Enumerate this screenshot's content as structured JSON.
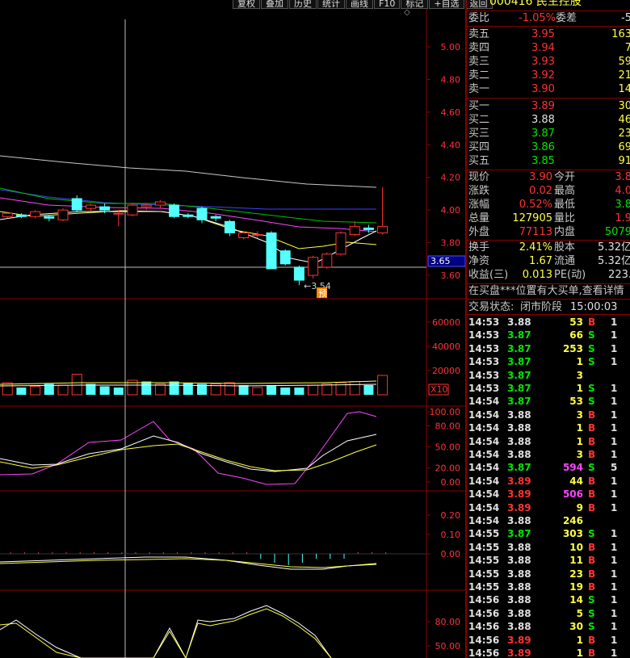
{
  "toolbar": [
    "复权",
    "叠加",
    "历史",
    "统计",
    "画线",
    "F10",
    "标记",
    "+自选",
    "返回"
  ],
  "crosshair_price": "3.65",
  "low_marker": "3.54",
  "badge": "预",
  "main_axis": [
    "5.00",
    "4.80",
    "4.60",
    "4.40",
    "4.20",
    "4.00",
    "3.80",
    "3.60"
  ],
  "vol_axis": [
    "60000",
    "40000",
    "20000"
  ],
  "vol_unit": "X10",
  "kdj_axis": [
    "100.00",
    "80.00",
    "50.00",
    "20.00",
    "0.00"
  ],
  "macd_axis": [
    "0.20",
    "0.10",
    "0.00"
  ],
  "osc_axis": [
    "80.00",
    "50.00"
  ],
  "chart_data": {
    "type": "candlestick",
    "ylim": [
      3.5,
      5.1
    ],
    "candles": [
      {
        "o": 3.95,
        "c": 3.93,
        "h": 3.97,
        "l": 3.91
      },
      {
        "o": 3.96,
        "c": 3.98,
        "h": 3.99,
        "l": 3.95
      },
      {
        "o": 3.97,
        "c": 3.96,
        "h": 3.98,
        "l": 3.95
      },
      {
        "o": 3.96,
        "c": 3.99,
        "h": 4.0,
        "l": 3.95
      },
      {
        "o": 3.96,
        "c": 3.95,
        "h": 3.97,
        "l": 3.93
      },
      {
        "o": 3.94,
        "c": 4.0,
        "h": 4.01,
        "l": 3.93
      },
      {
        "o": 4.07,
        "c": 4.0,
        "h": 4.09,
        "l": 3.99
      },
      {
        "o": 4.01,
        "c": 4.03,
        "h": 4.04,
        "l": 3.99
      },
      {
        "o": 4.02,
        "c": 4.0,
        "h": 4.04,
        "l": 3.98
      },
      {
        "o": 3.98,
        "c": 3.98,
        "h": 4.0,
        "l": 3.9
      },
      {
        "o": 3.97,
        "c": 4.03,
        "h": 4.04,
        "l": 3.96
      },
      {
        "o": 4.02,
        "c": 4.03,
        "h": 4.04,
        "l": 4.0
      },
      {
        "o": 4.03,
        "c": 4.05,
        "h": 4.06,
        "l": 4.01
      },
      {
        "o": 4.03,
        "c": 3.96,
        "h": 4.04,
        "l": 3.95
      },
      {
        "o": 3.97,
        "c": 3.96,
        "h": 3.98,
        "l": 3.95
      },
      {
        "o": 4.01,
        "c": 3.94,
        "h": 4.02,
        "l": 3.92
      },
      {
        "o": 3.96,
        "c": 3.95,
        "h": 3.97,
        "l": 3.93
      },
      {
        "o": 3.93,
        "c": 3.86,
        "h": 3.94,
        "l": 3.84
      },
      {
        "o": 3.83,
        "c": 3.86,
        "h": 3.87,
        "l": 3.82
      },
      {
        "o": 3.85,
        "c": 3.85,
        "h": 3.87,
        "l": 3.83
      },
      {
        "o": 3.86,
        "c": 3.64,
        "h": 3.87,
        "l": 3.64
      },
      {
        "o": 3.75,
        "c": 3.67,
        "h": 3.76,
        "l": 3.66
      },
      {
        "o": 3.65,
        "c": 3.57,
        "h": 3.66,
        "l": 3.54
      },
      {
        "o": 3.6,
        "c": 3.71,
        "h": 3.72,
        "l": 3.58
      },
      {
        "o": 3.65,
        "c": 3.73,
        "h": 3.74,
        "l": 3.64
      },
      {
        "o": 3.73,
        "c": 3.86,
        "h": 3.87,
        "l": 3.72
      },
      {
        "o": 3.85,
        "c": 3.9,
        "h": 3.93,
        "l": 3.84
      },
      {
        "o": 3.89,
        "c": 3.88,
        "h": 3.91,
        "l": 3.86
      },
      {
        "o": 3.86,
        "c": 3.9,
        "h": 4.14,
        "l": 3.85
      }
    ],
    "volume": [
      8000,
      10000,
      6000,
      7000,
      9000,
      8000,
      17000,
      9000,
      7000,
      6000,
      12000,
      11000,
      9000,
      11000,
      10000,
      9000,
      9000,
      10000,
      8000,
      6000,
      8000,
      6000,
      6000,
      8000,
      9000,
      10000,
      11000,
      8000,
      16000
    ],
    "volume_color": [
      "grn",
      "red",
      "grn",
      "red",
      "grn",
      "red",
      "red",
      "grn",
      "grn",
      "grn",
      "red",
      "grn",
      "red",
      "grn",
      "grn",
      "grn",
      "red",
      "red",
      "grn",
      "red",
      "grn",
      "grn",
      "grn",
      "red",
      "red",
      "red",
      "red",
      "grn",
      "red"
    ]
  },
  "stock_title": "000416 民生控股",
  "panel": {
    "rows1": [
      {
        "l": "委比",
        "v": "-1.05%",
        "vc": "red",
        "l2": "委差",
        "v2": "-5",
        "v2c": "wht"
      }
    ],
    "asks": [
      {
        "l": "卖五",
        "p": "3.95",
        "pc": "red",
        "q": "163"
      },
      {
        "l": "卖四",
        "p": "3.94",
        "pc": "red",
        "q": "7"
      },
      {
        "l": "卖三",
        "p": "3.93",
        "pc": "red",
        "q": "59"
      },
      {
        "l": "卖二",
        "p": "3.92",
        "pc": "red",
        "q": "21"
      },
      {
        "l": "卖一",
        "p": "3.90",
        "pc": "red",
        "q": "14"
      }
    ],
    "bids": [
      {
        "l": "买一",
        "p": "3.89",
        "pc": "red",
        "q": "30"
      },
      {
        "l": "买二",
        "p": "3.88",
        "pc": "wht",
        "q": "46"
      },
      {
        "l": "买三",
        "p": "3.87",
        "pc": "grn",
        "q": "23"
      },
      {
        "l": "买四",
        "p": "3.86",
        "pc": "grn",
        "q": "69"
      },
      {
        "l": "买五",
        "p": "3.85",
        "pc": "grn",
        "q": "91"
      }
    ],
    "stats": [
      {
        "l": "现价",
        "v": "3.90",
        "vc": "red",
        "l2": "今开",
        "v2": "3.8",
        "v2c": "red"
      },
      {
        "l": "涨跌",
        "v": "0.02",
        "vc": "red",
        "l2": "最高",
        "v2": "4.0",
        "v2c": "red"
      },
      {
        "l": "涨幅",
        "v": "0.52%",
        "vc": "red",
        "l2": "最低",
        "v2": "3.8",
        "v2c": "grn"
      },
      {
        "l": "总量",
        "v": "127905",
        "vc": "ylw",
        "l2": "量比",
        "v2": "1.9",
        "v2c": "red"
      },
      {
        "l": "外盘",
        "v": "77113",
        "vc": "red",
        "l2": "内盘",
        "v2": "5079",
        "v2c": "grn"
      }
    ],
    "stats2": [
      {
        "l": "换手",
        "v": "2.41%",
        "vc": "ylw",
        "l2": "股本",
        "v2": "5.32亿",
        "v2c": "wht"
      },
      {
        "l": "净资",
        "v": "1.67",
        "vc": "ylw",
        "l2": "流通",
        "v2": "5.32亿",
        "v2c": "wht"
      },
      {
        "l": "收益(三)",
        "v": "0.013",
        "vc": "ylw",
        "l2": "PE(动)",
        "v2": "223.",
        "v2c": "wht"
      }
    ],
    "notice": "在买盘***位置有大买单,查看详情",
    "state_label": "交易状态:",
    "state_value": "闭市阶段",
    "state_time": "15:00:03"
  },
  "ticks": [
    {
      "t": "14:53",
      "p": "3.88",
      "pc": "wht",
      "v": "53",
      "vc": "ylw",
      "s": "B",
      "sc": "red",
      "x": "1"
    },
    {
      "t": "14:53",
      "p": "3.87",
      "pc": "grn",
      "v": "66",
      "vc": "ylw",
      "s": "S",
      "sc": "grn",
      "x": "1"
    },
    {
      "t": "14:53",
      "p": "3.87",
      "pc": "grn",
      "v": "253",
      "vc": "ylw",
      "s": "S",
      "sc": "grn",
      "x": "1"
    },
    {
      "t": "14:53",
      "p": "3.87",
      "pc": "grn",
      "v": "1",
      "vc": "ylw",
      "s": "S",
      "sc": "grn",
      "x": "1"
    },
    {
      "t": "14:53",
      "p": "3.87",
      "pc": "grn",
      "v": "3",
      "vc": "ylw",
      "s": "",
      "sc": "grn",
      "x": ""
    },
    {
      "t": "14:53",
      "p": "3.87",
      "pc": "grn",
      "v": "1",
      "vc": "ylw",
      "s": "S",
      "sc": "grn",
      "x": "1"
    },
    {
      "t": "14:54",
      "p": "3.87",
      "pc": "grn",
      "v": "53",
      "vc": "ylw",
      "s": "S",
      "sc": "grn",
      "x": "1"
    },
    {
      "t": "14:54",
      "p": "3.88",
      "pc": "wht",
      "v": "3",
      "vc": "ylw",
      "s": "B",
      "sc": "red",
      "x": "1"
    },
    {
      "t": "14:54",
      "p": "3.88",
      "pc": "wht",
      "v": "1",
      "vc": "ylw",
      "s": "B",
      "sc": "red",
      "x": "1"
    },
    {
      "t": "14:54",
      "p": "3.88",
      "pc": "wht",
      "v": "1",
      "vc": "ylw",
      "s": "B",
      "sc": "red",
      "x": "1"
    },
    {
      "t": "14:54",
      "p": "3.88",
      "pc": "wht",
      "v": "3",
      "vc": "ylw",
      "s": "B",
      "sc": "red",
      "x": "1"
    },
    {
      "t": "14:54",
      "p": "3.87",
      "pc": "grn",
      "v": "594",
      "vc": "mag",
      "s": "S",
      "sc": "grn",
      "x": "5"
    },
    {
      "t": "14:54",
      "p": "3.89",
      "pc": "red",
      "v": "44",
      "vc": "ylw",
      "s": "B",
      "sc": "red",
      "x": "1"
    },
    {
      "t": "14:54",
      "p": "3.89",
      "pc": "red",
      "v": "506",
      "vc": "mag",
      "s": "B",
      "sc": "red",
      "x": "1"
    },
    {
      "t": "14:54",
      "p": "3.89",
      "pc": "red",
      "v": "9",
      "vc": "ylw",
      "s": "B",
      "sc": "red",
      "x": "1"
    },
    {
      "t": "14:54",
      "p": "3.88",
      "pc": "wht",
      "v": "246",
      "vc": "ylw",
      "s": "",
      "sc": "red",
      "x": ""
    },
    {
      "t": "14:55",
      "p": "3.87",
      "pc": "grn",
      "v": "303",
      "vc": "ylw",
      "s": "S",
      "sc": "grn",
      "x": "1"
    },
    {
      "t": "14:55",
      "p": "3.88",
      "pc": "wht",
      "v": "10",
      "vc": "ylw",
      "s": "B",
      "sc": "red",
      "x": "1"
    },
    {
      "t": "14:55",
      "p": "3.88",
      "pc": "wht",
      "v": "11",
      "vc": "ylw",
      "s": "B",
      "sc": "red",
      "x": "1"
    },
    {
      "t": "14:55",
      "p": "3.88",
      "pc": "wht",
      "v": "23",
      "vc": "ylw",
      "s": "B",
      "sc": "red",
      "x": "1"
    },
    {
      "t": "14:55",
      "p": "3.88",
      "pc": "wht",
      "v": "19",
      "vc": "ylw",
      "s": "B",
      "sc": "red",
      "x": "1"
    },
    {
      "t": "14:56",
      "p": "3.88",
      "pc": "wht",
      "v": "14",
      "vc": "ylw",
      "s": "S",
      "sc": "grn",
      "x": "1"
    },
    {
      "t": "14:56",
      "p": "3.88",
      "pc": "wht",
      "v": "5",
      "vc": "ylw",
      "s": "S",
      "sc": "grn",
      "x": "1"
    },
    {
      "t": "14:56",
      "p": "3.88",
      "pc": "wht",
      "v": "30",
      "vc": "ylw",
      "s": "S",
      "sc": "grn",
      "x": "1"
    },
    {
      "t": "14:56",
      "p": "3.89",
      "pc": "red",
      "v": "1",
      "vc": "ylw",
      "s": "B",
      "sc": "red",
      "x": "1"
    },
    {
      "t": "14:56",
      "p": "3.89",
      "pc": "red",
      "v": "1",
      "vc": "ylw",
      "s": "B",
      "sc": "red",
      "x": "1"
    }
  ]
}
